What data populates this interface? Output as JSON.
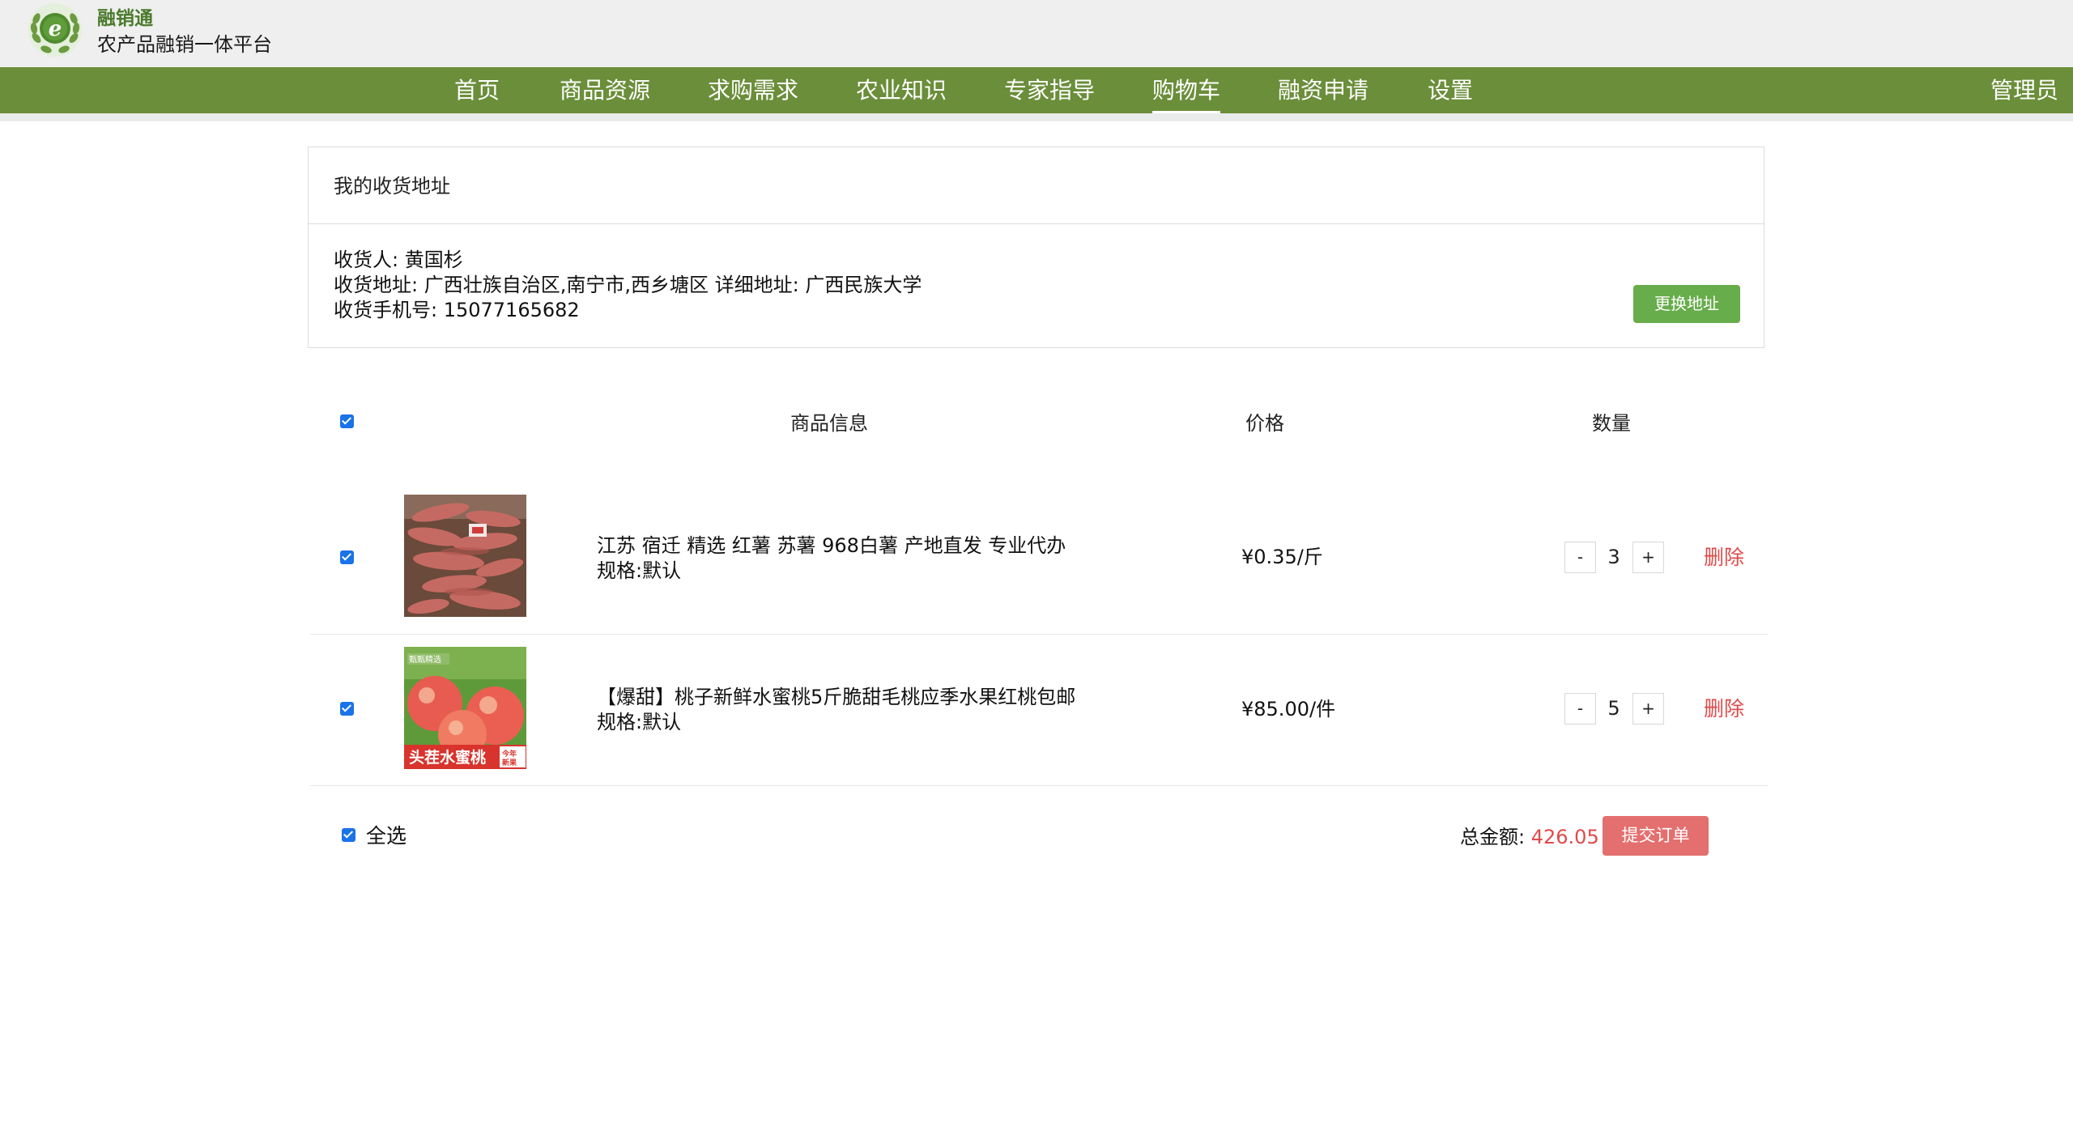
{
  "header": {
    "brand_name": "融销通",
    "brand_subtitle": "农产品融销一体平台",
    "logo_letter": "e"
  },
  "nav": {
    "items": [
      {
        "label": "首页"
      },
      {
        "label": "商品资源"
      },
      {
        "label": "求购需求"
      },
      {
        "label": "农业知识"
      },
      {
        "label": "专家指导"
      },
      {
        "label": "购物车",
        "active": true
      },
      {
        "label": "融资申请"
      },
      {
        "label": "设置"
      }
    ],
    "user": "管理员"
  },
  "address": {
    "title": "我的收货地址",
    "receiver": "收货人: 黄国杉",
    "address": "收货地址: 广西壮族自治区,南宁市,西乡塘区 详细地址: 广西民族大学",
    "phone": "收货手机号: 15077165682",
    "change_button": "更换地址"
  },
  "cart": {
    "columns": {
      "info": "商品信息",
      "price": "价格",
      "qty": "数量"
    },
    "items": [
      {
        "title": "江苏 宿迁 精选 红薯 苏薯 968白薯 产地直发 专业代办",
        "spec": "规格:默认",
        "price": "¥0.35/斤",
        "qty": "3",
        "delete": "删除",
        "checked": true
      },
      {
        "title": "【爆甜】桃子新鲜水蜜桃5斤脆甜毛桃应季水果红桃包邮",
        "spec": "规格:默认",
        "price": "¥85.00/件",
        "qty": "5",
        "delete": "删除",
        "checked": true,
        "image_text": "头茬水蜜桃",
        "image_badge_top": "甄甄精选",
        "image_badge_corner": "今年新果"
      }
    ],
    "qty_minus": "-",
    "qty_plus": "+",
    "select_all": "全选",
    "total_label": "总金额:",
    "total_value": "426.05",
    "submit": "提交订单"
  }
}
